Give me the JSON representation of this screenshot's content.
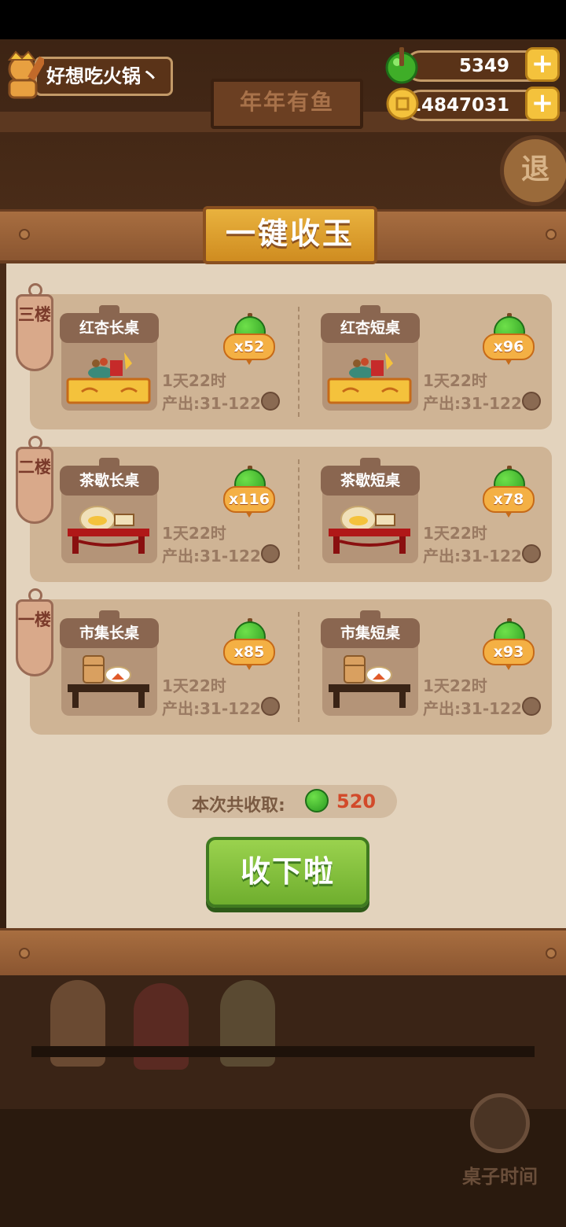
{
  "header": {
    "player_name": "好想吃火锅丶",
    "jade_balance": "5349",
    "coin_balance": "14847031",
    "plus_label": "+",
    "shop_plaque": "年年有鱼",
    "exit_label": "退"
  },
  "modal": {
    "title": "一键收玉",
    "floors": [
      {
        "label": "三楼",
        "tables": [
          {
            "name": "红杏长桌",
            "count": "x52",
            "time": "1天22时",
            "output": "产出:31-122"
          },
          {
            "name": "红杏短桌",
            "count": "x96",
            "time": "1天22时",
            "output": "产出:31-122"
          }
        ]
      },
      {
        "label": "二楼",
        "tables": [
          {
            "name": "茶歇长桌",
            "count": "x116",
            "time": "1天22时",
            "output": "产出:31-122"
          },
          {
            "name": "茶歇短桌",
            "count": "x78",
            "time": "1天22时",
            "output": "产出:31-122"
          }
        ]
      },
      {
        "label": "一楼",
        "tables": [
          {
            "name": "市集长桌",
            "count": "x85",
            "time": "1天22时",
            "output": "产出:31-122"
          },
          {
            "name": "市集短桌",
            "count": "x93",
            "time": "1天22时",
            "output": "产出:31-122"
          }
        ]
      }
    ],
    "total_label": "本次共收取:",
    "total_value": "520",
    "collect_button": "收下啦"
  },
  "footer": {
    "table_time_label": "桌子时间"
  },
  "colors": {
    "jade_green": "#3fae28",
    "button_green": "#7ab83a",
    "title_gold": "#e0a030",
    "total_red": "#d24a2a"
  },
  "icons": {
    "jade": "jade-icon",
    "coin": "coin-icon",
    "plus": "plus-icon",
    "clock": "clock-icon"
  }
}
